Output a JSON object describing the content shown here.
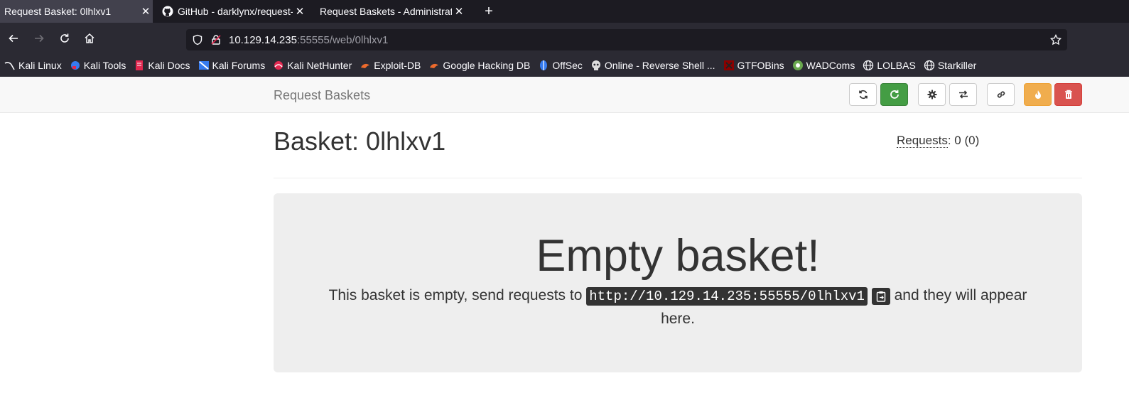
{
  "browser": {
    "tabs": [
      {
        "title": "Request Basket: 0lhlxv1",
        "active": true
      },
      {
        "title": "GitHub - darklynx/request-baskets",
        "active": false
      },
      {
        "title": "Request Baskets - Administration",
        "active": false
      }
    ],
    "url_host": "10.129.14.235",
    "url_rest": ":55555/web/0lhlxv1",
    "bookmarks": [
      "Kali Linux",
      "Kali Tools",
      "Kali Docs",
      "Kali Forums",
      "Kali NetHunter",
      "Exploit-DB",
      "Google Hacking DB",
      "OffSec",
      "Online - Reverse Shell ...",
      "GTFOBins",
      "WADComs",
      "LOLBAS",
      "Starkiller"
    ]
  },
  "page": {
    "brand": "Request Baskets",
    "title": "Basket: 0lhlxv1",
    "requests_label": "Requests",
    "requests_value": ": 0 (0)",
    "empty_heading": "Empty basket!",
    "empty_text_before": "This basket is empty, send requests to",
    "basket_url": "http://10.129.14.235:55555/0lhlxv1",
    "empty_text_after": "and they will appear here."
  },
  "colors": {
    "success": "#449d44",
    "warning": "#f0ad4e",
    "danger": "#d9534f"
  }
}
